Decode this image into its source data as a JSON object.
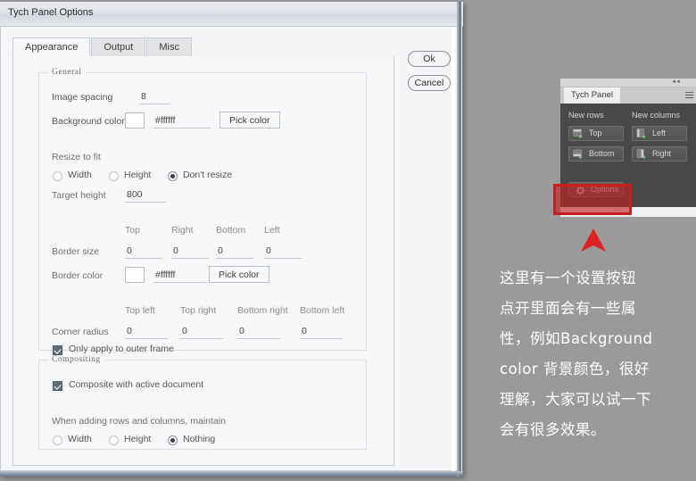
{
  "window": {
    "title": "Tych Panel Options"
  },
  "tabs": [
    {
      "label": "Appearance",
      "active": true
    },
    {
      "label": "Output",
      "active": false
    },
    {
      "label": "Misc",
      "active": false
    }
  ],
  "actions": {
    "ok_label": "Ok",
    "cancel_label": "Cancel"
  },
  "general": {
    "legend": "General",
    "image_spacing_label": "Image spacing",
    "image_spacing_value": "8",
    "background_color_label": "Background color",
    "background_color_value": "#ffffff",
    "background_swatch_hex": "#ffffff",
    "pick_color_label": "Pick color",
    "resize_to_fit_label": "Resize to fit",
    "resize_options": [
      {
        "label": "Width",
        "selected": false
      },
      {
        "label": "Height",
        "selected": false
      },
      {
        "label": "Don't resize",
        "selected": true
      }
    ],
    "target_height_label": "Target height",
    "target_height_value": "800",
    "border_headers": [
      "Top",
      "Right",
      "Bottom",
      "Left"
    ],
    "border_size_label": "Border size",
    "border_size_values": [
      "0",
      "0",
      "0",
      "0"
    ],
    "border_color_label": "Border color",
    "border_color_value": "#ffffff",
    "border_swatch_hex": "#ffffff",
    "border_pick_color_label": "Pick color",
    "corner_headers": [
      "Top left",
      "Top right",
      "Bottom right",
      "Bottom left"
    ],
    "corner_radius_label": "Corner radius",
    "corner_radius_values": [
      "0",
      "0",
      "0",
      "0"
    ],
    "outer_frame_label": "Only apply to outer frame",
    "outer_frame_checked": true
  },
  "compositing": {
    "legend": "Compositing",
    "composite_label": "Composite with active document",
    "composite_checked": true,
    "maintain_label": "When adding rows and columns, maintain",
    "maintain_options": [
      {
        "label": "Width",
        "selected": false
      },
      {
        "label": "Height",
        "selected": false
      },
      {
        "label": "Nothing",
        "selected": true
      }
    ]
  },
  "tych_panel": {
    "tab_label": "Tych Panel",
    "new_rows_label": "New rows",
    "new_columns_label": "New columns",
    "buttons": [
      {
        "label": "Top",
        "icon": "add-row-top-icon"
      },
      {
        "label": "Bottom",
        "icon": "add-row-bottom-icon"
      },
      {
        "label": "Left",
        "icon": "add-column-left-icon"
      },
      {
        "label": "Right",
        "icon": "add-column-right-icon"
      }
    ],
    "options_label": "Options",
    "options_icon": "gear-icon"
  },
  "annotation": {
    "highlight_color": "#c42020",
    "arrow_color": "#e02020",
    "lines": [
      "这里有一个设置按钮",
      "点开里面会有一些属",
      "性，例如Background",
      "color 背景颜色，很好",
      "理解，大家可以试一下",
      "会有很多效果。"
    ]
  }
}
